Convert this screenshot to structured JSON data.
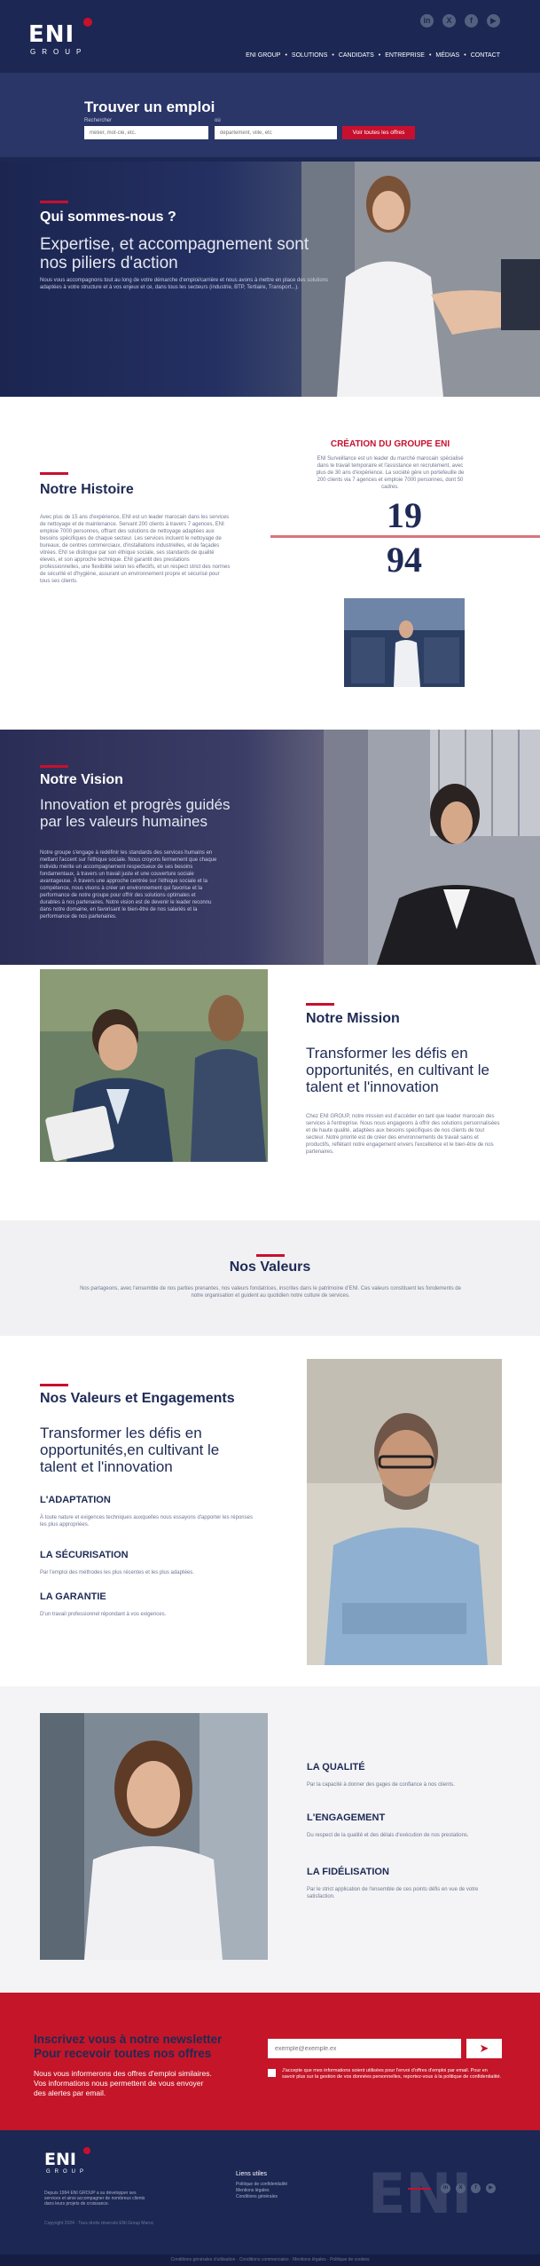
{
  "header": {
    "logo_text": "ENI",
    "logo_sub": "GROUP",
    "social_icons": [
      "linkedin-icon",
      "x-icon",
      "facebook-icon",
      "youtube-icon"
    ],
    "nav": [
      "ENI GROUP",
      "SOLUTIONS",
      "CANDIDATS",
      "ENTREPRISE",
      "MÉDIAS",
      "CONTACT"
    ]
  },
  "search": {
    "title": "Trouver un emploi",
    "keyword_label": "Rechercher",
    "keyword_placeholder": "métier, mot-clé, etc.",
    "location_label": "où",
    "location_placeholder": "département, ville, etc",
    "button": "Voir toutes les offres"
  },
  "about": {
    "title": "Qui sommes-nous ?",
    "lead": "Expertise, et accompagnement sont nos piliers d'action",
    "body": "Nous vous accompagnons tout au long de votre démarche d'emploi/carrière et nous avons à mettre en place des solutions adaptées à votre structure et à vos enjeux et ce, dans tous les secteurs (industrie, BTP, Tertiaire, Transport...)."
  },
  "histoire": {
    "title": "Notre Histoire",
    "body": "Avec plus de 15 ans d'expérience, ENI est un leader marocain dans les services de nettoyage et de maintenance. Servant 200 clients à travers 7 agences, ENI emploie 7000 personnes, offrant des solutions de nettoyage adaptées aux besoins spécifiques de chaque secteur. Les services incluent le nettoyage de bureaux, de centres commerciaux, d'installations industrielles, et de façades vitrées. ENI se distingue par son éthique sociale, ses standards de qualité élevés, et son approche technique. ENI garantit des prestations professionnelles, une flexibilité selon les effectifs, et un respect strict des normes de sécurité et d'hygiène, assurant un environnement propre et sécurisé pour tous ses clients.",
    "creation_title": "CRÉATION DU GROUPE ENI",
    "creation_body": "ENI Surveillance est un leader du marché marocain spécialisé dans le travail temporaire et l'assistance en recrutement, avec plus de 30 ans d'expérience. La société gère un portefeuille de 200 clients via 7 agences et emploie 7000 personnes, dont 50 cadres.",
    "year_top": "19",
    "year_bottom": "94"
  },
  "vision": {
    "title": "Notre Vision",
    "lead": "Innovation et progrès guidés par les valeurs humaines",
    "body": "Notre groupe s'engage à redéfinir les standards des services humains en mettant l'accent sur l'éthique sociale. Nous croyons fermement que chaque individu mérite un accompagnement respectueux de ses besoins fondamentaux, à travers un travail juste et une couverture sociale avantageuse. À travers une approche centrée sur l'éthique sociale et la compétence, nous visons à créer un environnement qui favorise et la performance de notre groupe pour offrir des solutions optimales et durables à nos partenaires. Notre vision est de devenir le leader reconnu dans notre domaine, en favorisant le bien-être de nos salariés et la performance de nos partenaires."
  },
  "mission": {
    "title": "Notre Mission",
    "lead": "Transformer les défis en opportunités, en cultivant le talent et l'innovation",
    "body": "Chez ENI GROUP, notre mission est d'accéder en tant que leader marocain des services à l'entreprise. Nous nous engageons à offrir des solutions personnalisées et de haute qualité, adaptées aux besoins spécifiques de nos clients de tout secteur. Notre priorité est de créer des environnements de travail sains et productifs, reflétant notre engagement envers l'excellence et le bien-être de nos partenaires."
  },
  "valeurs": {
    "title": "Nos Valeurs",
    "body": "Nos partageons, avec l'ensemble de nos parties prenantes, nos valeurs fondatrices, inscrites dans le patrimoine d'ENI. Ces valeurs constituent les fondements de notre organisation et guident au quotidien notre culture de services."
  },
  "engagements": {
    "title": "Nos Valeurs et Engagements",
    "lead": "Transformer les défis en opportunités,en cultivant le talent et l'innovation",
    "items": [
      {
        "title": "L'ADAPTATION",
        "text": "À toute nature et exigences techniques auxquelles nous essayons d'apporter les réponses les plus appropriées."
      },
      {
        "title": "LA SÉCURISATION",
        "text": "Par l'emploi des méthodes les plus récentes et les plus adaptées."
      },
      {
        "title": "LA GARANTIE",
        "text": "D'un travail professionnel répondant à vos exigences."
      }
    ],
    "items2": [
      {
        "title": "LA QUALITÉ",
        "text": "Par la capacité à donner des gages de confiance à nos clients."
      },
      {
        "title": "L'ENGAGEMENT",
        "text": "Du respect de la qualité et des délais d'exécution de nos prestations."
      },
      {
        "title": "LA FIDÉLISATION",
        "text": "Par le strict application de l'ensemble de ces points défis en vue de votre satisfaction."
      }
    ]
  },
  "newsletter": {
    "title_1": "Inscrivez vous à notre newsletter",
    "title_2": "Pour recevoir toutes nos offres",
    "body_1": "Nous vous informerons des offres d'emploi similaires.",
    "body_2": "Vos informations nous permettent de vous envoyer",
    "body_3": "des alertes par email.",
    "email_placeholder": "exemple@exemple.ex",
    "consent": "J'accepte que mes informations soient utilisées pour l'envoi d'offres d'emploi par email. Pour en savoir plus sur la gestion de vos données personnelles, reportez-vous à la politique de confidentialité."
  },
  "footer": {
    "logo_text": "ENI",
    "logo_sub": "GROUP",
    "body": "Depuis 1994 ENI GROUP a su développer ses services et ainsi accompagner de nombreux clients dans leurs projets de croissance.",
    "copyright": "Copyright 2024 · Tous droits réservés ENI Group Maroc",
    "links_title": "Liens utiles",
    "links": [
      "Politique de confidentialité",
      "Mentions légales",
      "Conditions générales"
    ],
    "social_icons": [
      "linkedin-icon",
      "x-icon",
      "facebook-icon",
      "youtube-icon"
    ],
    "bottom_bar": "Conditions générales d'utilisation · Conditions commerciales · Mentions légales · Politique de cookies"
  },
  "colors": {
    "navy": "#1c2753",
    "red": "#c8102e",
    "gray_bg": "#f1f1f3"
  }
}
